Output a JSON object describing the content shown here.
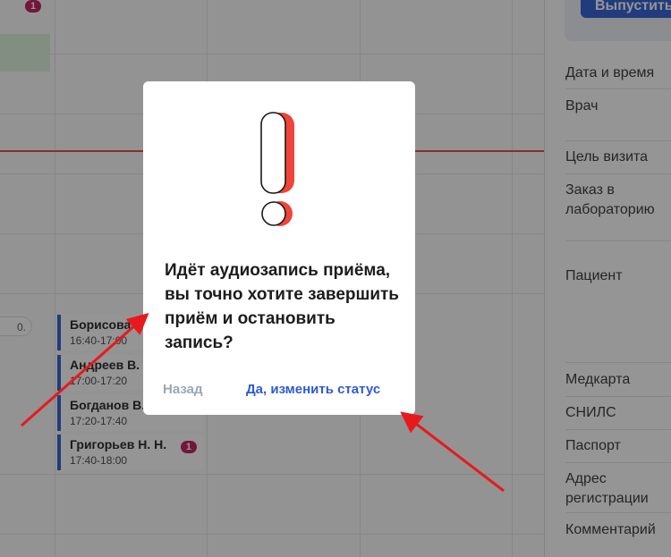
{
  "calendar": {
    "top_badge": "1",
    "partial_pill": "0.",
    "appointments": [
      {
        "name": "Борисова",
        "time": "16:40-17:00",
        "badge": ""
      },
      {
        "name": "Андреев В.",
        "time": "17:00-17:20",
        "badge": ""
      },
      {
        "name": "Богданов В.",
        "time": "17:20-17:40",
        "badge": ""
      },
      {
        "name": "Григорьев Н. Н.",
        "time": "17:40-18:00",
        "badge": "1"
      }
    ]
  },
  "sidebar": {
    "release_button": "Выпустить",
    "fields": [
      "Дата и время",
      "Врач",
      "Цель визита",
      "Заказ в лабораторию",
      "Пациент",
      "Медкарта",
      "СНИЛС",
      "Паспорт",
      "Адрес регистрации",
      "Комментарий"
    ]
  },
  "modal": {
    "icon": "exclamation-icon",
    "message": "Идёт аудиозапись приёма, вы точно хотите завершить приём и остановить запись?",
    "back_label": "Назад",
    "confirm_label": "Да, изменить статус"
  },
  "colors": {
    "accent": "#2e5bd3",
    "alert": "#f0443a",
    "annotation_arrow": "#e8191c",
    "badge": "#c2185b"
  }
}
